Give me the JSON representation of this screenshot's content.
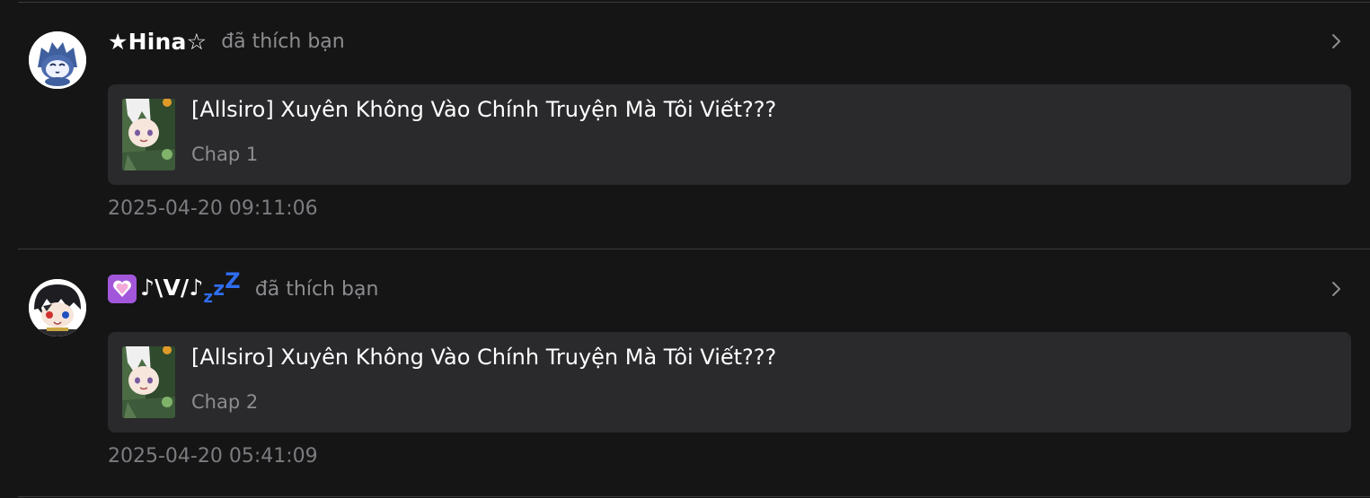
{
  "notifications": [
    {
      "username": "★Hina☆",
      "action": "đã thích bạn",
      "avatar_icon": "wolf-cat-avatar-icon",
      "story": {
        "title": "[Allsiro] Xuyên Không Vào Chính Truyện Mà Tôi Viết???",
        "chapter": "Chap 1",
        "cover_icon": "anime-cover-icon"
      },
      "timestamp": "2025-04-20 09:11:06"
    },
    {
      "username_emoji": "💟",
      "username": "♪\\V/♪",
      "username_suffix": [
        "z",
        "z",
        "Z"
      ],
      "action": "đã thích bạn",
      "avatar_icon": "anime-boy-avatar-icon",
      "story": {
        "title": "[Allsiro] Xuyên Không Vào Chính Truyện Mà Tôi Viết???",
        "chapter": "Chap 2",
        "cover_icon": "anime-cover-icon"
      },
      "timestamp": "2025-04-20 05:41:09"
    }
  ],
  "colors": {
    "background": "#151516",
    "card": "#2a2a2c",
    "muted_text": "#8d8d90",
    "divider": "#3b3b3d",
    "zzz_blue": "#2f6df0"
  }
}
